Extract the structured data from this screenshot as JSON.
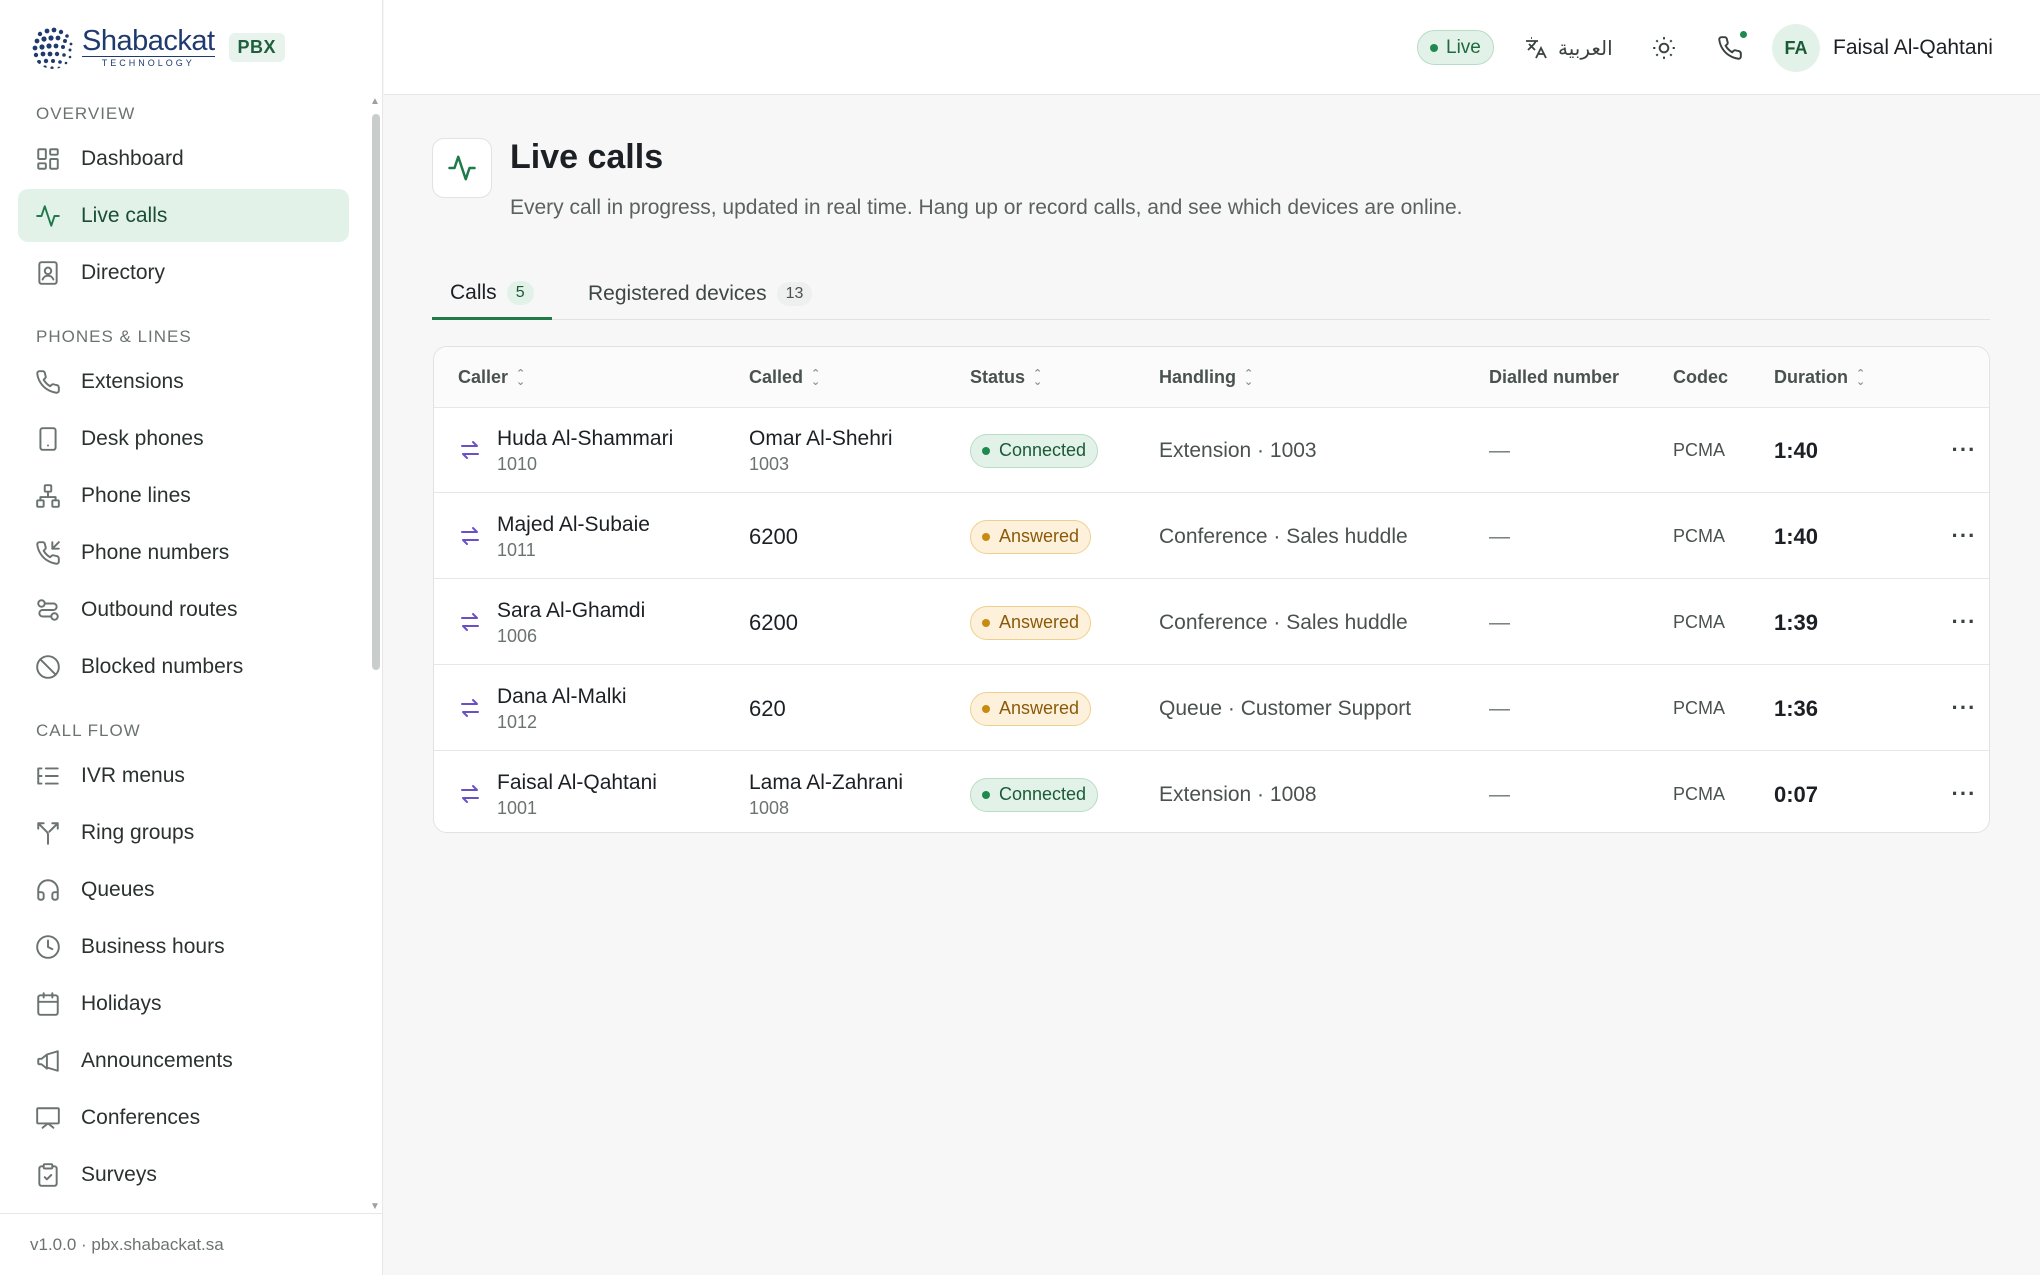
{
  "brand": {
    "word": "Shabackat",
    "sub": "TECHNOLOGY",
    "badge": "PBX"
  },
  "sidebar": {
    "sections": [
      {
        "title": "OVERVIEW",
        "items": [
          {
            "label": "Dashboard",
            "icon": "dashboard-icon"
          },
          {
            "label": "Live calls",
            "icon": "activity-icon",
            "active": true
          },
          {
            "label": "Directory",
            "icon": "contact-book-icon"
          }
        ]
      },
      {
        "title": "PHONES & LINES",
        "items": [
          {
            "label": "Extensions",
            "icon": "phone-icon"
          },
          {
            "label": "Desk phones",
            "icon": "device-icon"
          },
          {
            "label": "Phone lines",
            "icon": "network-icon"
          },
          {
            "label": "Phone numbers",
            "icon": "phone-incoming-icon"
          },
          {
            "label": "Outbound routes",
            "icon": "route-icon"
          },
          {
            "label": "Blocked numbers",
            "icon": "ban-icon"
          }
        ]
      },
      {
        "title": "CALL FLOW",
        "items": [
          {
            "label": "IVR menus",
            "icon": "list-tree-icon"
          },
          {
            "label": "Ring groups",
            "icon": "split-icon"
          },
          {
            "label": "Queues",
            "icon": "headphones-icon"
          },
          {
            "label": "Business hours",
            "icon": "clock-icon"
          },
          {
            "label": "Holidays",
            "icon": "calendar-icon"
          },
          {
            "label": "Announcements",
            "icon": "megaphone-icon"
          },
          {
            "label": "Conferences",
            "icon": "presentation-icon"
          },
          {
            "label": "Surveys",
            "icon": "clipboard-check-icon"
          }
        ]
      }
    ],
    "footer": "v1.0.0 · pbx.shabackat.sa"
  },
  "topbar": {
    "live_label": "Live",
    "language_label": "العربية",
    "user_initials": "FA",
    "user_name": "Faisal Al-Qahtani"
  },
  "page": {
    "title": "Live calls",
    "subtitle": "Every call in progress, updated in real time. Hang up or record calls, and see which devices are online."
  },
  "tabs": [
    {
      "label": "Calls",
      "count": "5",
      "active": true
    },
    {
      "label": "Registered devices",
      "count": "13"
    }
  ],
  "table": {
    "columns": [
      "Caller",
      "Called",
      "Status",
      "Handling",
      "Dialled number",
      "Codec",
      "Duration"
    ],
    "rows": [
      {
        "caller": "Huda Al-Shammari",
        "caller_ext": "1010",
        "called": "Omar Al-Shehri",
        "called_ext": "1003",
        "status": "Connected",
        "status_kind": "connected",
        "handling": "Extension · 1003",
        "dialled": "—",
        "codec": "PCMA",
        "duration": "1:40"
      },
      {
        "caller": "Majed Al-Subaie",
        "caller_ext": "1011",
        "called": "6200",
        "called_ext": "",
        "status": "Answered",
        "status_kind": "answered",
        "handling": "Conference · Sales huddle",
        "dialled": "—",
        "codec": "PCMA",
        "duration": "1:40"
      },
      {
        "caller": "Sara Al-Ghamdi",
        "caller_ext": "1006",
        "called": "6200",
        "called_ext": "",
        "status": "Answered",
        "status_kind": "answered",
        "handling": "Conference · Sales huddle",
        "dialled": "—",
        "codec": "PCMA",
        "duration": "1:39"
      },
      {
        "caller": "Dana Al-Malki",
        "caller_ext": "1012",
        "called": "620",
        "called_ext": "",
        "status": "Answered",
        "status_kind": "answered",
        "handling": "Queue · Customer Support",
        "dialled": "—",
        "codec": "PCMA",
        "duration": "1:36"
      },
      {
        "caller": "Faisal Al-Qahtani",
        "caller_ext": "1001",
        "called": "Lama Al-Zahrani",
        "called_ext": "1008",
        "status": "Connected",
        "status_kind": "connected",
        "handling": "Extension · 1008",
        "dialled": "—",
        "codec": "PCMA",
        "duration": "0:07"
      }
    ]
  },
  "colors": {
    "accent": "#1f7a4a",
    "accent_bg": "#e3f2e8",
    "answered": "#c98a12",
    "direction_icon": "#6a4fc9"
  }
}
